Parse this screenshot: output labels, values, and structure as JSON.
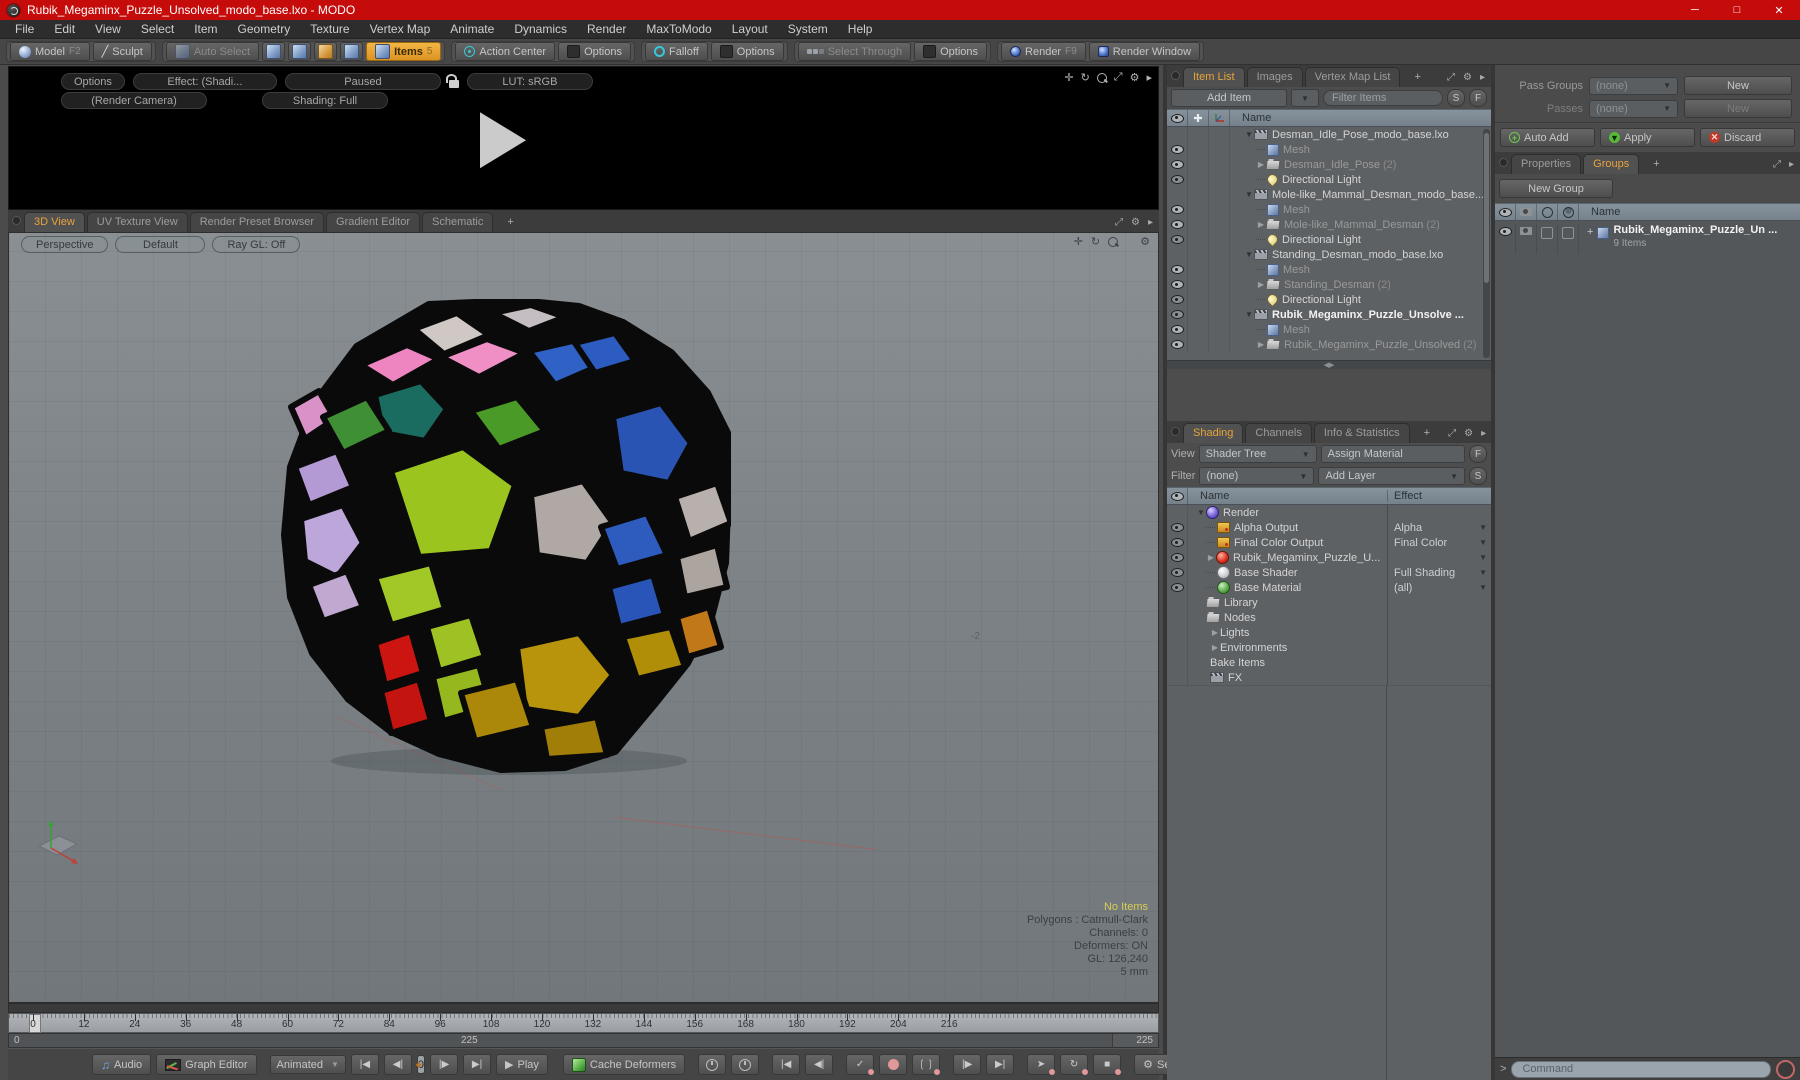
{
  "window": {
    "title": "Rubik_Megaminx_Puzzle_Unsolved_modo_base.lxo - MODO"
  },
  "menu": {
    "items": [
      "File",
      "Edit",
      "View",
      "Select",
      "Item",
      "Geometry",
      "Texture",
      "Vertex Map",
      "Animate",
      "Dynamics",
      "Render",
      "MaxToModo",
      "Layout",
      "System",
      "Help"
    ]
  },
  "toolbar": {
    "model": "Model",
    "model_key": "F2",
    "sculpt": "Sculpt",
    "auto_select": "Auto Select",
    "items": "Items",
    "items_count": "5",
    "action_center": "Action Center",
    "options_a": "Options",
    "falloff": "Falloff",
    "options_b": "Options",
    "select_through": "Select Through",
    "options_c": "Options",
    "render": "Render",
    "render_key": "F9",
    "render_window": "Render Window"
  },
  "preview": {
    "options": "Options",
    "effect": "Effect: (Shadi...",
    "paused": "Paused",
    "lut": "LUT: sRGB",
    "camera": "(Render Camera)",
    "shading": "Shading: Full"
  },
  "viewport": {
    "tabs": [
      "3D View",
      "UV Texture View",
      "Render Preset Browser",
      "Gradient Editor",
      "Schematic"
    ],
    "plus_tab": "+",
    "perspective": "Perspective",
    "default": "Default",
    "raygl": "Ray GL: Off",
    "grid_label": "-2",
    "stats": {
      "no_items": "No Items",
      "polygons": "Polygons : Catmull-Clark",
      "channels": "Channels: 0",
      "deformers": "Deformers: ON",
      "gl": "GL: 126,240",
      "scale": "5 mm"
    }
  },
  "item_list": {
    "tabs": [
      "Item List",
      "Images",
      "Vertex Map List"
    ],
    "plus_tab": "+",
    "add_item": "Add Item",
    "filter_placeholder": "Filter Items",
    "s": "S",
    "f": "F",
    "name_header": "Name",
    "rows": [
      {
        "label": "Desman_Idle_Pose_modo_base.lxo",
        "suffix": "",
        "type": "scene",
        "state": "expanded",
        "eye": false,
        "dim": false,
        "bold": false
      },
      {
        "label": "Mesh",
        "suffix": "",
        "type": "mesh",
        "state": "leaf",
        "eye": true,
        "dim": true,
        "bold": false
      },
      {
        "label": "Desman_Idle_Pose",
        "suffix": "(2)",
        "type": "folder",
        "state": "collapsed",
        "eye": true,
        "dim": true,
        "bold": false
      },
      {
        "label": "Directional Light",
        "suffix": "",
        "type": "light",
        "state": "leaf",
        "eye": true,
        "dim": false,
        "bold": false
      },
      {
        "label": "Mole-like_Mammal_Desman_modo_base....",
        "suffix": "",
        "type": "scene",
        "state": "expanded",
        "eye": false,
        "dim": false,
        "bold": false
      },
      {
        "label": "Mesh",
        "suffix": "",
        "type": "mesh",
        "state": "leaf",
        "eye": true,
        "dim": true,
        "bold": false
      },
      {
        "label": "Mole-like_Mammal_Desman",
        "suffix": "(2)",
        "type": "folder",
        "state": "collapsed",
        "eye": true,
        "dim": true,
        "bold": false
      },
      {
        "label": "Directional Light",
        "suffix": "",
        "type": "light",
        "state": "leaf",
        "eye": true,
        "dim": false,
        "bold": false
      },
      {
        "label": "Standing_Desman_modo_base.lxo",
        "suffix": "",
        "type": "scene",
        "state": "expanded",
        "eye": false,
        "dim": false,
        "bold": false
      },
      {
        "label": "Mesh",
        "suffix": "",
        "type": "mesh",
        "state": "leaf",
        "eye": true,
        "dim": true,
        "bold": false
      },
      {
        "label": "Standing_Desman",
        "suffix": "(2)",
        "type": "folder",
        "state": "collapsed",
        "eye": true,
        "dim": true,
        "bold": false
      },
      {
        "label": "Directional Light",
        "suffix": "",
        "type": "light",
        "state": "leaf",
        "eye": true,
        "dim": false,
        "bold": false
      },
      {
        "label": "Rubik_Megaminx_Puzzle_Unsolve ...",
        "suffix": "",
        "type": "scene",
        "state": "expanded",
        "eye": true,
        "dim": false,
        "bold": true
      },
      {
        "label": "Mesh",
        "suffix": "",
        "type": "mesh",
        "state": "leaf",
        "eye": true,
        "dim": true,
        "bold": false
      },
      {
        "label": "Rubik_Megaminx_Puzzle_Unsolved",
        "suffix": "(2)",
        "type": "folder",
        "state": "collapsed",
        "eye": true,
        "dim": true,
        "bold": false
      }
    ]
  },
  "shading": {
    "tabs": [
      "Shading",
      "Channels",
      "Info & Statistics"
    ],
    "plus_tab": "+",
    "view_label": "View",
    "view_value": "Shader Tree",
    "assign_material": "Assign Material",
    "f": "F",
    "filter_label": "Filter",
    "filter_value": "(none)",
    "add_layer": "Add Layer",
    "s": "S",
    "name_header": "Name",
    "effect_header": "Effect",
    "rows": [
      {
        "label": "Render",
        "effect": "",
        "icon": "render",
        "state": "expanded",
        "eye": false,
        "dd": false
      },
      {
        "label": "Alpha Output",
        "effect": "Alpha",
        "icon": "output",
        "state": "leaf",
        "eye": true,
        "dd": true
      },
      {
        "label": "Final Color Output",
        "effect": "Final Color",
        "icon": "output",
        "state": "leaf",
        "eye": true,
        "dd": true
      },
      {
        "label": "Rubik_Megaminx_Puzzle_U...",
        "effect": "",
        "icon": "red",
        "state": "collapsed",
        "eye": true,
        "dd": true
      },
      {
        "label": "Base Shader",
        "effect": "Full Shading",
        "icon": "white",
        "state": "leaf",
        "eye": true,
        "dd": true
      },
      {
        "label": "Base Material",
        "effect": "(all)",
        "icon": "green",
        "state": "leaf",
        "eye": true,
        "dd": true
      },
      {
        "label": "Library",
        "effect": "",
        "icon": "folder",
        "state": "none",
        "eye": false,
        "dd": false
      },
      {
        "label": "Nodes",
        "effect": "",
        "icon": "folder",
        "state": "none",
        "eye": false,
        "dd": false
      },
      {
        "label": "Lights",
        "effect": "",
        "icon": "",
        "state": "collapsed2",
        "eye": false,
        "dd": false
      },
      {
        "label": "Environments",
        "effect": "",
        "icon": "",
        "state": "collapsed2",
        "eye": false,
        "dd": false
      },
      {
        "label": "Bake Items",
        "effect": "",
        "icon": "",
        "state": "none",
        "eye": false,
        "dd": false
      },
      {
        "label": "FX",
        "effect": "",
        "icon": "clap",
        "state": "none",
        "eye": false,
        "dd": false
      }
    ]
  },
  "passes": {
    "pass_groups_label": "Pass Groups",
    "pass_groups_value": "(none)",
    "new_a": "New",
    "passes_label": "Passes",
    "passes_value": "(none)",
    "new_b": "New",
    "auto_add": "Auto Add",
    "apply": "Apply",
    "discard": "Discard"
  },
  "groups": {
    "tabs": [
      "Properties",
      "Groups"
    ],
    "plus_tab": "+",
    "new_group": "New Group",
    "name_header": "Name",
    "item_label": "Rubik_Megaminx_Puzzle_Un ...",
    "item_count": "9 Items"
  },
  "timeline": {
    "ticks": [
      "0",
      "12",
      "24",
      "36",
      "48",
      "60",
      "72",
      "84",
      "96",
      "108",
      "120",
      "132",
      "144",
      "156",
      "168",
      "180",
      "192",
      "204",
      "216"
    ],
    "range_start": "0",
    "range_mid": "225",
    "range_end": "225"
  },
  "transport": {
    "audio": "Audio",
    "graph_editor": "Graph Editor",
    "animated": "Animated",
    "frame": "0",
    "play": "Play",
    "cache_deformers": "Cache Deformers",
    "settings": "Settings"
  },
  "command": {
    "prompt": ">",
    "placeholder": "Command"
  }
}
